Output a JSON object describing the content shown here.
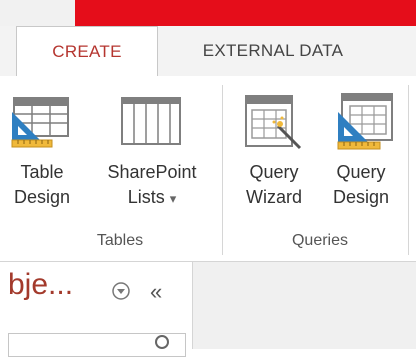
{
  "ribbon": {
    "tabs": [
      {
        "label": "CREATE",
        "active": true
      },
      {
        "label": "EXTERNAL DATA",
        "active": false
      }
    ],
    "groups": {
      "tables": {
        "label": "Tables",
        "buttons": {
          "table_design": {
            "line1": "Table",
            "line2": "Design"
          },
          "sharepoint_lists": {
            "line1": "SharePoint",
            "line2": "Lists",
            "dropdown": "▾"
          }
        }
      },
      "queries": {
        "label": "Queries",
        "buttons": {
          "query_wizard": {
            "line1": "Query",
            "line2": "Wizard"
          },
          "query_design": {
            "line1": "Query",
            "line2": "Design"
          }
        }
      }
    }
  },
  "nav_pane": {
    "title": "bje...",
    "collapse_glyph": "«"
  },
  "colors": {
    "title_bar_red": "#e50d1a",
    "active_tab_text": "#b5352f",
    "nav_title": "#a33a2c"
  }
}
